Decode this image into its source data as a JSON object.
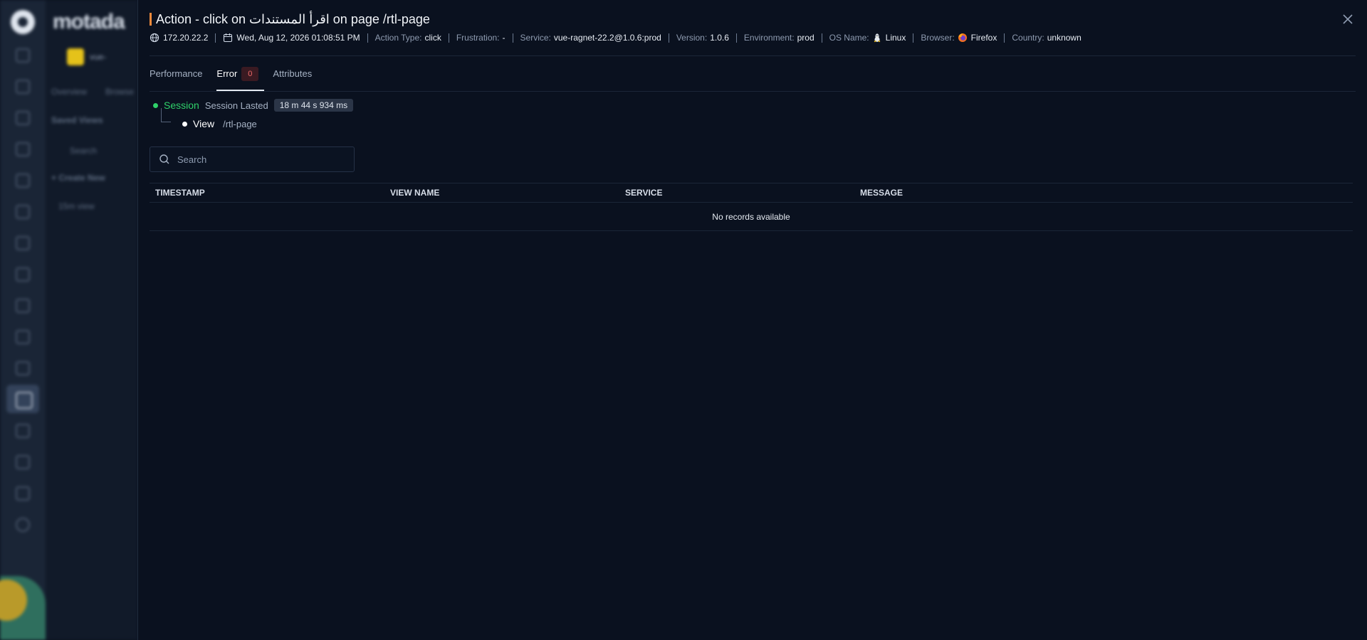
{
  "background": {
    "brand": "motada",
    "project_label": "vue-",
    "nav_tabs": [
      "Overview",
      "Browse"
    ],
    "saved_views_label": "Saved Views",
    "search_placeholder": "Search",
    "create_new_label": "+ Create New",
    "view_item": "15m view"
  },
  "header": {
    "title": "Action - click on اقرأ المستندات on page /rtl-page",
    "close_icon": "close-icon"
  },
  "meta": {
    "ip": "172.20.22.2",
    "date": "Wed, Aug 12, 2026 01:08:51 PM",
    "action_type_label": "Action Type:",
    "action_type": "click",
    "frustration_label": "Frustration:",
    "frustration": "-",
    "service_label": "Service:",
    "service": "vue-ragnet-22.2@1.0.6:prod",
    "version_label": "Version:",
    "version": "1.0.6",
    "environment_label": "Environment:",
    "environment": "prod",
    "os_label": "OS Name:",
    "os": "Linux",
    "browser_label": "Browser:",
    "browser": "Firefox",
    "country_label": "Country:",
    "country": "unknown"
  },
  "tabs": [
    {
      "label": "Performance"
    },
    {
      "label": "Error",
      "badge": "0"
    },
    {
      "label": "Attributes"
    }
  ],
  "tree": {
    "session_label": "Session",
    "lasted_label": "Session Lasted",
    "duration": "18 m 44 s 934 ms",
    "view_label": "View",
    "view_value": "/rtl-page"
  },
  "search": {
    "placeholder": "Search"
  },
  "table": {
    "columns": [
      "TIMESTAMP",
      "VIEW NAME",
      "SERVICE",
      "MESSAGE"
    ],
    "empty_text": "No records available"
  },
  "colors": {
    "accent": "#f08a3c",
    "session_green": "#2fd16a",
    "error_badge": "#f06a6a"
  }
}
